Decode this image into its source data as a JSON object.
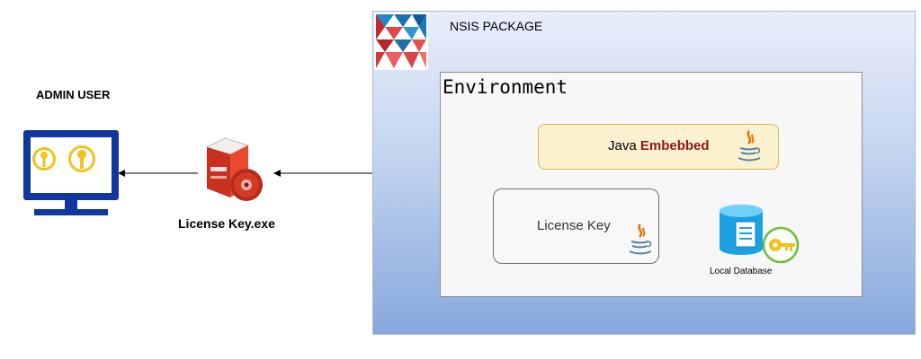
{
  "left": {
    "admin_label": "ADMIN USER",
    "exe_label": "License Key.exe"
  },
  "package": {
    "title": "NSIS PACKAGE",
    "environment": {
      "title": "Environment",
      "java_box": {
        "label_prefix": "Java ",
        "label_emphasis": "Embebbed"
      },
      "license_box": {
        "label": "License Key"
      },
      "database": {
        "label": "Local Database"
      }
    }
  },
  "colors": {
    "monitor_blue": "#10379e",
    "key_yellow": "#f2c21b",
    "installer_red": "#d6361f",
    "java_orange": "#e76f00",
    "java_blue": "#5382a1",
    "db_blue": "#1ba1e2"
  }
}
